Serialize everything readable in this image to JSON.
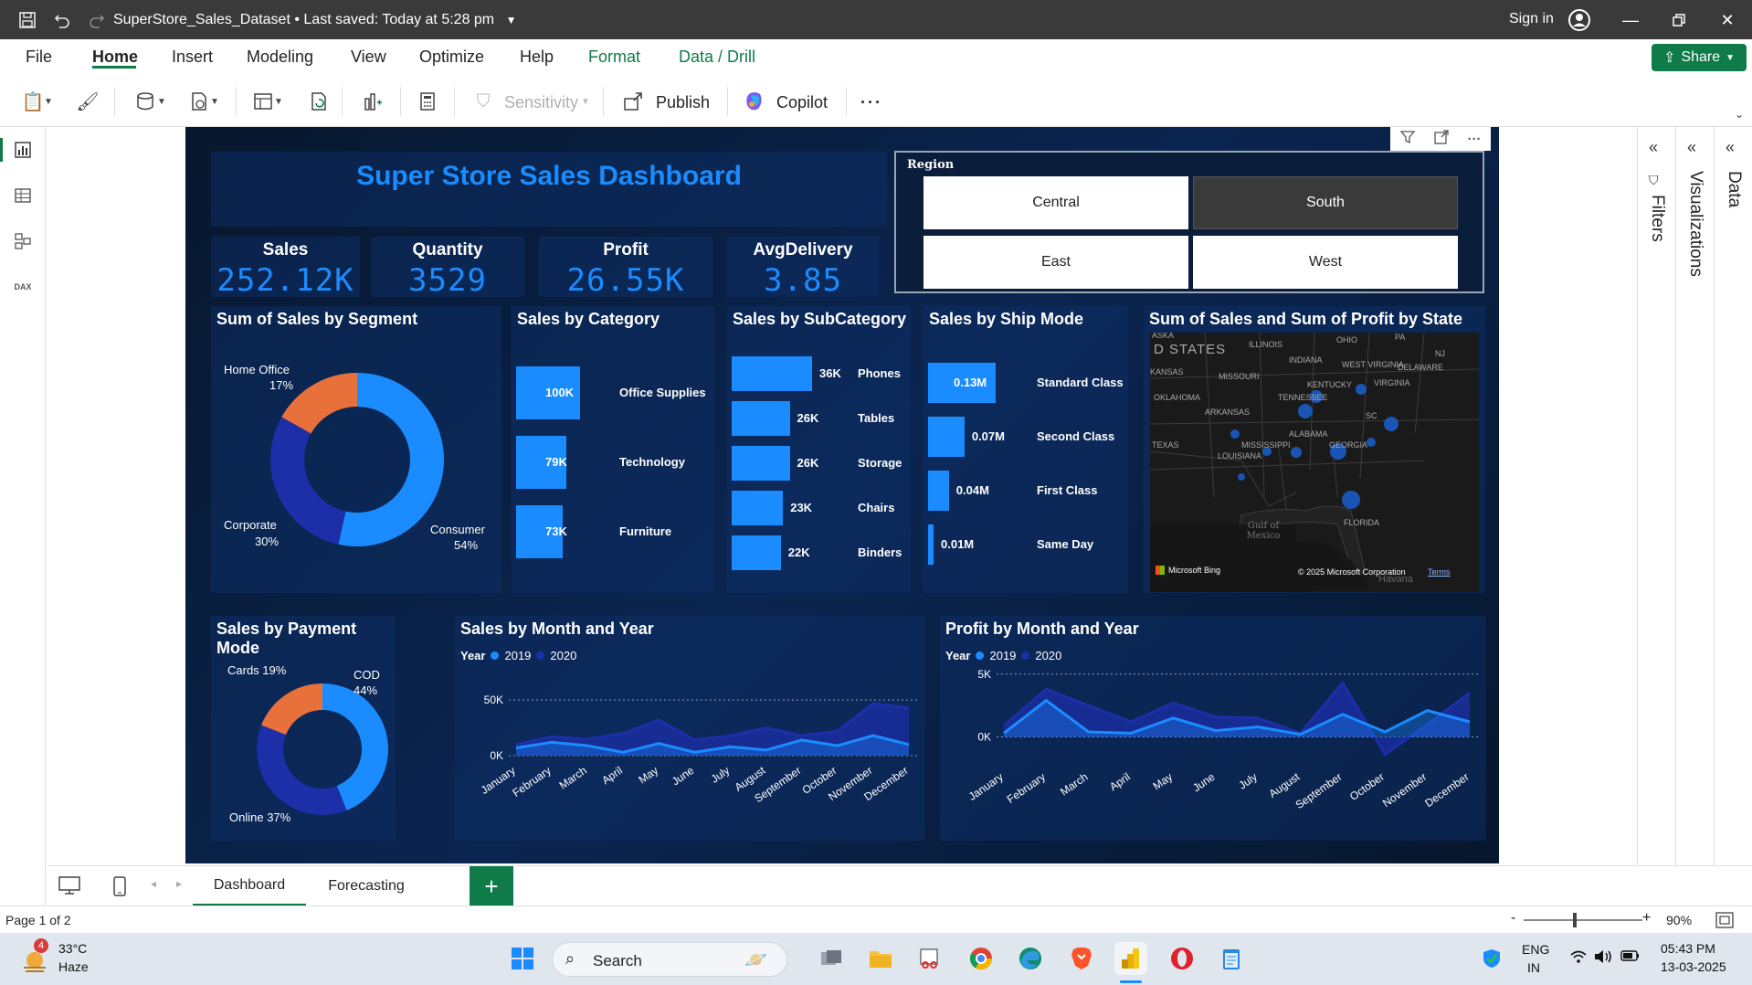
{
  "window": {
    "title": "SuperStore_Sales_Dataset",
    "saved_status": "Last saved: Today at 5:28 pm",
    "sign_in": "Sign in"
  },
  "menu": {
    "items": [
      "File",
      "Home",
      "Insert",
      "Modeling",
      "View",
      "Optimize",
      "Help",
      "Format",
      "Data / Drill"
    ],
    "share": "Share"
  },
  "ribbon": {
    "sensitivity": "Sensitivity",
    "publish": "Publish",
    "copilot": "Copilot",
    "more": "···"
  },
  "dashboard": {
    "title": "Super Store Sales Dashboard",
    "kpis": [
      {
        "label": "Sales",
        "value": "252.12K"
      },
      {
        "label": "Quantity",
        "value": "3529"
      },
      {
        "label": "Profit",
        "value": "26.55K"
      },
      {
        "label": "AvgDelivery",
        "value": "3.85"
      }
    ],
    "region_slicer": {
      "title": "Region",
      "options": [
        "Central",
        "South",
        "East",
        "West"
      ],
      "selected": "South"
    },
    "segment": {
      "title": "Sum of Sales by Segment",
      "slices": [
        {
          "name": "Consumer",
          "pct": "54%",
          "value": 54,
          "color": "#1a8cff"
        },
        {
          "name": "Corporate",
          "pct": "30%",
          "value": 30,
          "color": "#1c2fa8"
        },
        {
          "name": "Home Office",
          "pct": "17%",
          "value": 17,
          "color": "#e8703a"
        }
      ]
    },
    "category": {
      "title": "Sales by Category",
      "bars": [
        {
          "name": "Office Supplies",
          "label": "100K",
          "value": 100
        },
        {
          "name": "Technology",
          "label": "79K",
          "value": 79
        },
        {
          "name": "Furniture",
          "label": "73K",
          "value": 73
        }
      ]
    },
    "subcategory": {
      "title": "Sales by SubCategory",
      "bars": [
        {
          "name": "Phones",
          "label": "36K",
          "value": 36
        },
        {
          "name": "Tables",
          "label": "26K",
          "value": 26
        },
        {
          "name": "Storage",
          "label": "26K",
          "value": 26
        },
        {
          "name": "Chairs",
          "label": "23K",
          "value": 23
        },
        {
          "name": "Binders",
          "label": "22K",
          "value": 22
        }
      ]
    },
    "shipmode": {
      "title": "Sales by Ship Mode",
      "bars": [
        {
          "name": "Standard Class",
          "label": "0.13M",
          "value": 0.13
        },
        {
          "name": "Second Class",
          "label": "0.07M",
          "value": 0.07
        },
        {
          "name": "First Class",
          "label": "0.04M",
          "value": 0.04
        },
        {
          "name": "Same Day",
          "label": "0.01M",
          "value": 0.01
        }
      ]
    },
    "map": {
      "title": "Sum of Sales and Sum of Profit by State",
      "country_label": "D STATES",
      "state_labels": [
        "ILLINOIS",
        "OHIO",
        "PA",
        "INDIANA",
        "MISSOURI",
        "WEST VIRGINIA",
        "KANSAS",
        "KENTUCKY",
        "VIRGINIA",
        "DELAWARE",
        "OKLAHOMA",
        "TENNESSEE",
        "ARKANSAS",
        "SC",
        "ALABAMA",
        "MISSISSIPPI",
        "GEORGIA",
        "TEXAS",
        "LOUISIANA",
        "FLORIDA",
        "ASKA",
        "NJ"
      ],
      "water_label": "Gulf of Mexico",
      "attribution_left": "Microsoft Bing",
      "attribution_right": "© 2025 Microsoft Corporation",
      "terms": "Terms",
      "extra": "Havana"
    },
    "payment": {
      "title": "Sales by Payment Mode",
      "slices": [
        {
          "name": "COD",
          "pct": "44%",
          "value": 44,
          "color": "#1a8cff"
        },
        {
          "name": "Online",
          "pct": "37%",
          "value": 37,
          "color": "#1c2fa8"
        },
        {
          "name": "Cards",
          "pct": "19%",
          "value": 19,
          "color": "#e8703a"
        }
      ],
      "labels": {
        "cod": "COD",
        "cod_pct": "44%",
        "online": "Online 37%",
        "cards": "Cards 19%"
      }
    },
    "sales_month": {
      "title": "Sales by Month and Year",
      "legend_title": "Year",
      "series_names": [
        "2019",
        "2020"
      ],
      "y_ticks": [
        "50K",
        "0K"
      ]
    },
    "profit_month": {
      "title": "Profit by Month and Year",
      "legend_title": "Year",
      "series_names": [
        "2019",
        "2020"
      ],
      "y_ticks": [
        "5K",
        "0K"
      ]
    }
  },
  "chart_data": [
    {
      "type": "area",
      "title": "Sales by Month and Year",
      "categories": [
        "January",
        "February",
        "March",
        "April",
        "May",
        "June",
        "July",
        "August",
        "September",
        "October",
        "November",
        "December"
      ],
      "ylim": [
        0,
        60
      ],
      "series": [
        {
          "name": "2019",
          "values": [
            7,
            12,
            9,
            3,
            11,
            3,
            8,
            5,
            14,
            9,
            18,
            10
          ]
        },
        {
          "name": "2020",
          "values": [
            10,
            17,
            15,
            20,
            32,
            14,
            18,
            25,
            18,
            22,
            47,
            43
          ]
        }
      ]
    },
    {
      "type": "area",
      "title": "Profit by Month and Year",
      "categories": [
        "January",
        "February",
        "March",
        "April",
        "May",
        "June",
        "July",
        "August",
        "September",
        "October",
        "November",
        "December"
      ],
      "ylim": [
        -2,
        6
      ],
      "series": [
        {
          "name": "2019",
          "values": [
            0.3,
            2.9,
            0.4,
            0.3,
            1.5,
            0.5,
            0.8,
            0.2,
            1.8,
            0.4,
            2.1,
            1.2
          ]
        },
        {
          "name": "2020",
          "values": [
            0.9,
            3.8,
            2.5,
            1.2,
            2.7,
            1.6,
            1.5,
            0.3,
            4.3,
            -1.4,
            1.0,
            3.5
          ]
        }
      ]
    }
  ],
  "tabs": {
    "items": [
      "Dashboard",
      "Forecasting"
    ],
    "active": "Dashboard",
    "add": "+"
  },
  "status": {
    "page": "Page 1 of 2",
    "zoom": "90%",
    "minus": "-",
    "plus": "+"
  },
  "taskbar": {
    "weather_temp": "33°C",
    "weather_desc": "Haze",
    "weather_badge": "4",
    "search": "Search",
    "lang": "ENG",
    "region": "IN",
    "time": "05:43 PM",
    "date": "13-03-2025"
  }
}
